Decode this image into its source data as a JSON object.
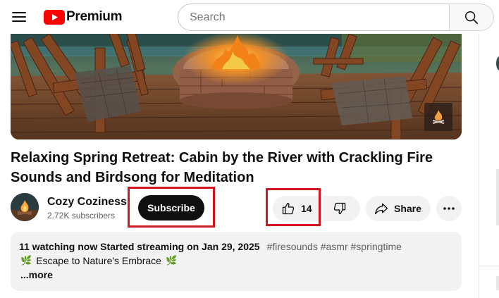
{
  "header": {
    "menu_icon": "hamburger-menu-icon",
    "logo_text": "Premium",
    "brand_color": "#ff0000",
    "search_placeholder": "Search",
    "search_icon": "search-icon"
  },
  "video": {
    "title": "Relaxing Spring Retreat: Cabin by the River with Crackling Fire Sounds and Birdsong for Meditation"
  },
  "channel": {
    "name": "Cozy Coziness",
    "subscribers": "2.72K subscribers",
    "subscribe_label": "Subscribe"
  },
  "actions": {
    "like_count": "14",
    "like_icon": "thumbs-up-icon",
    "dislike_icon": "thumbs-down-icon",
    "share_label": "Share",
    "share_icon": "share-icon",
    "more_icon": "more-horizontal-icon"
  },
  "description": {
    "watching": "11 watching now",
    "started": "Started streaming on Jan 29, 2025",
    "tags": "#firesounds #asmr #springtime",
    "headline": "Escape to Nature's Embrace",
    "more_label": "...more"
  },
  "colors": {
    "highlight_box": "#d0161e",
    "subscribe_bg": "#0f0f0f",
    "chip_bg": "#f2f2f2"
  }
}
